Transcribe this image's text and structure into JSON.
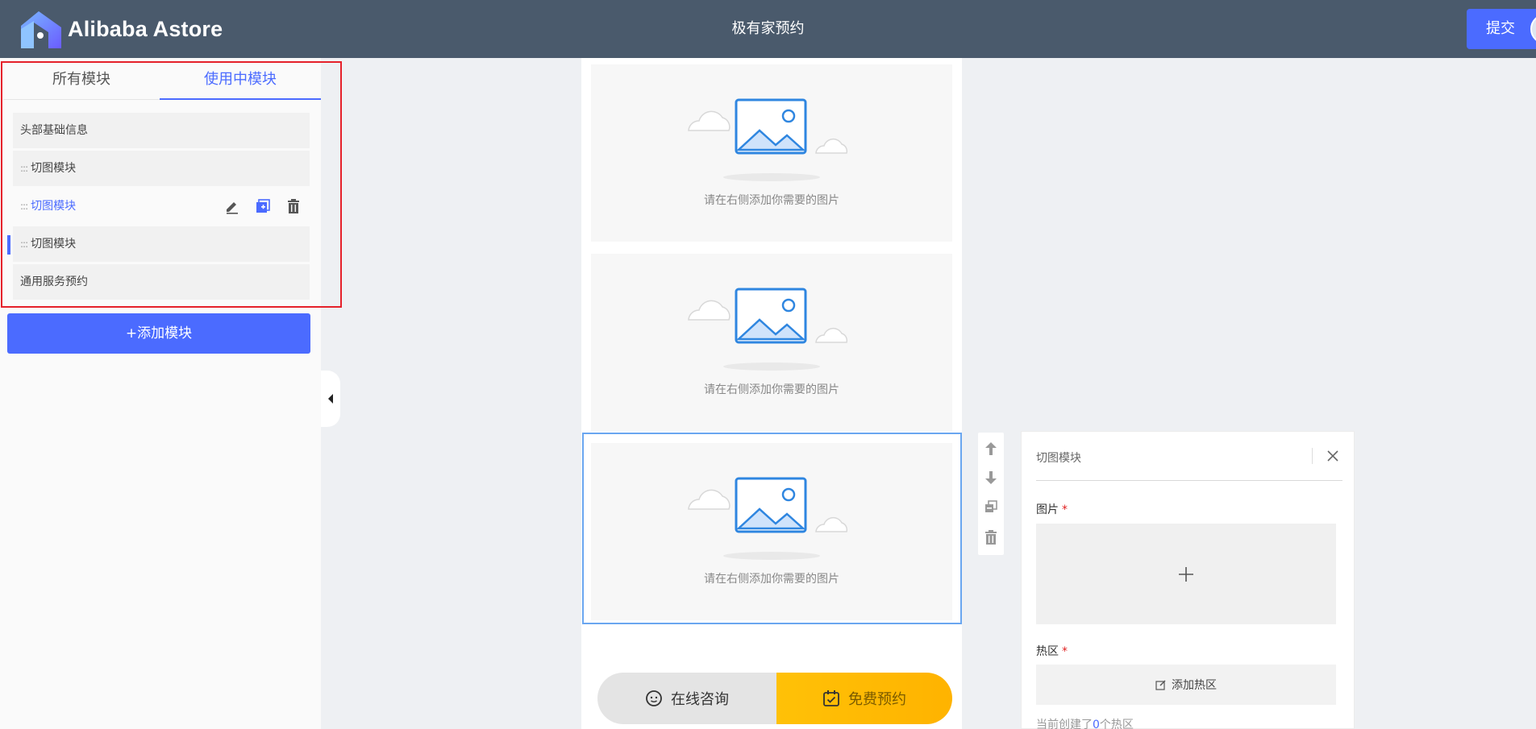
{
  "header": {
    "logo_text": "Alibaba Astore",
    "title": "极有家预约",
    "submit_label": "提交"
  },
  "left_panel": {
    "tabs": [
      {
        "label": "所有模块",
        "active": false
      },
      {
        "label": "使用中模块",
        "active": true
      }
    ],
    "modules": [
      {
        "label": "头部基础信息",
        "draggable": false
      },
      {
        "label": "切图模块",
        "draggable": true
      },
      {
        "label": "切图模块",
        "draggable": true,
        "active": true
      },
      {
        "label": "切图模块",
        "draggable": true
      },
      {
        "label": "通用服务预约",
        "draggable": false
      }
    ],
    "drag_handle": ":::",
    "add_button": "+添加模块"
  },
  "canvas": {
    "placeholder_text": "请在右侧添加你需要的图片",
    "placeholder_count": 3,
    "selected_index": 2
  },
  "bottom_bar": {
    "consult_label": "在线咨询",
    "reserve_label": "免费预约"
  },
  "config_panel": {
    "title": "切图模块",
    "image_label": "图片",
    "hotzone_label": "热区",
    "required_mark": "*",
    "add_hotzone_label": "添加热区",
    "hint_prefix": "当前创建了",
    "hint_count": "0",
    "hint_suffix": "个热区"
  },
  "colors": {
    "header_bg": "#4a5a6c",
    "accent": "#4b6bff",
    "reserve": "#ffc107",
    "selection": "#6aa6f0",
    "highlight_box": "#e5212a"
  },
  "icons": [
    "logo-mark-icon",
    "edit-icon",
    "copy-add-icon",
    "trash-icon",
    "arrow-up-icon",
    "arrow-down-icon",
    "copy-icon",
    "close-icon",
    "plus-icon",
    "edit-box-icon",
    "smile-chat-icon",
    "calendar-check-icon",
    "caret-left-icon",
    "image-placeholder-icon"
  ]
}
